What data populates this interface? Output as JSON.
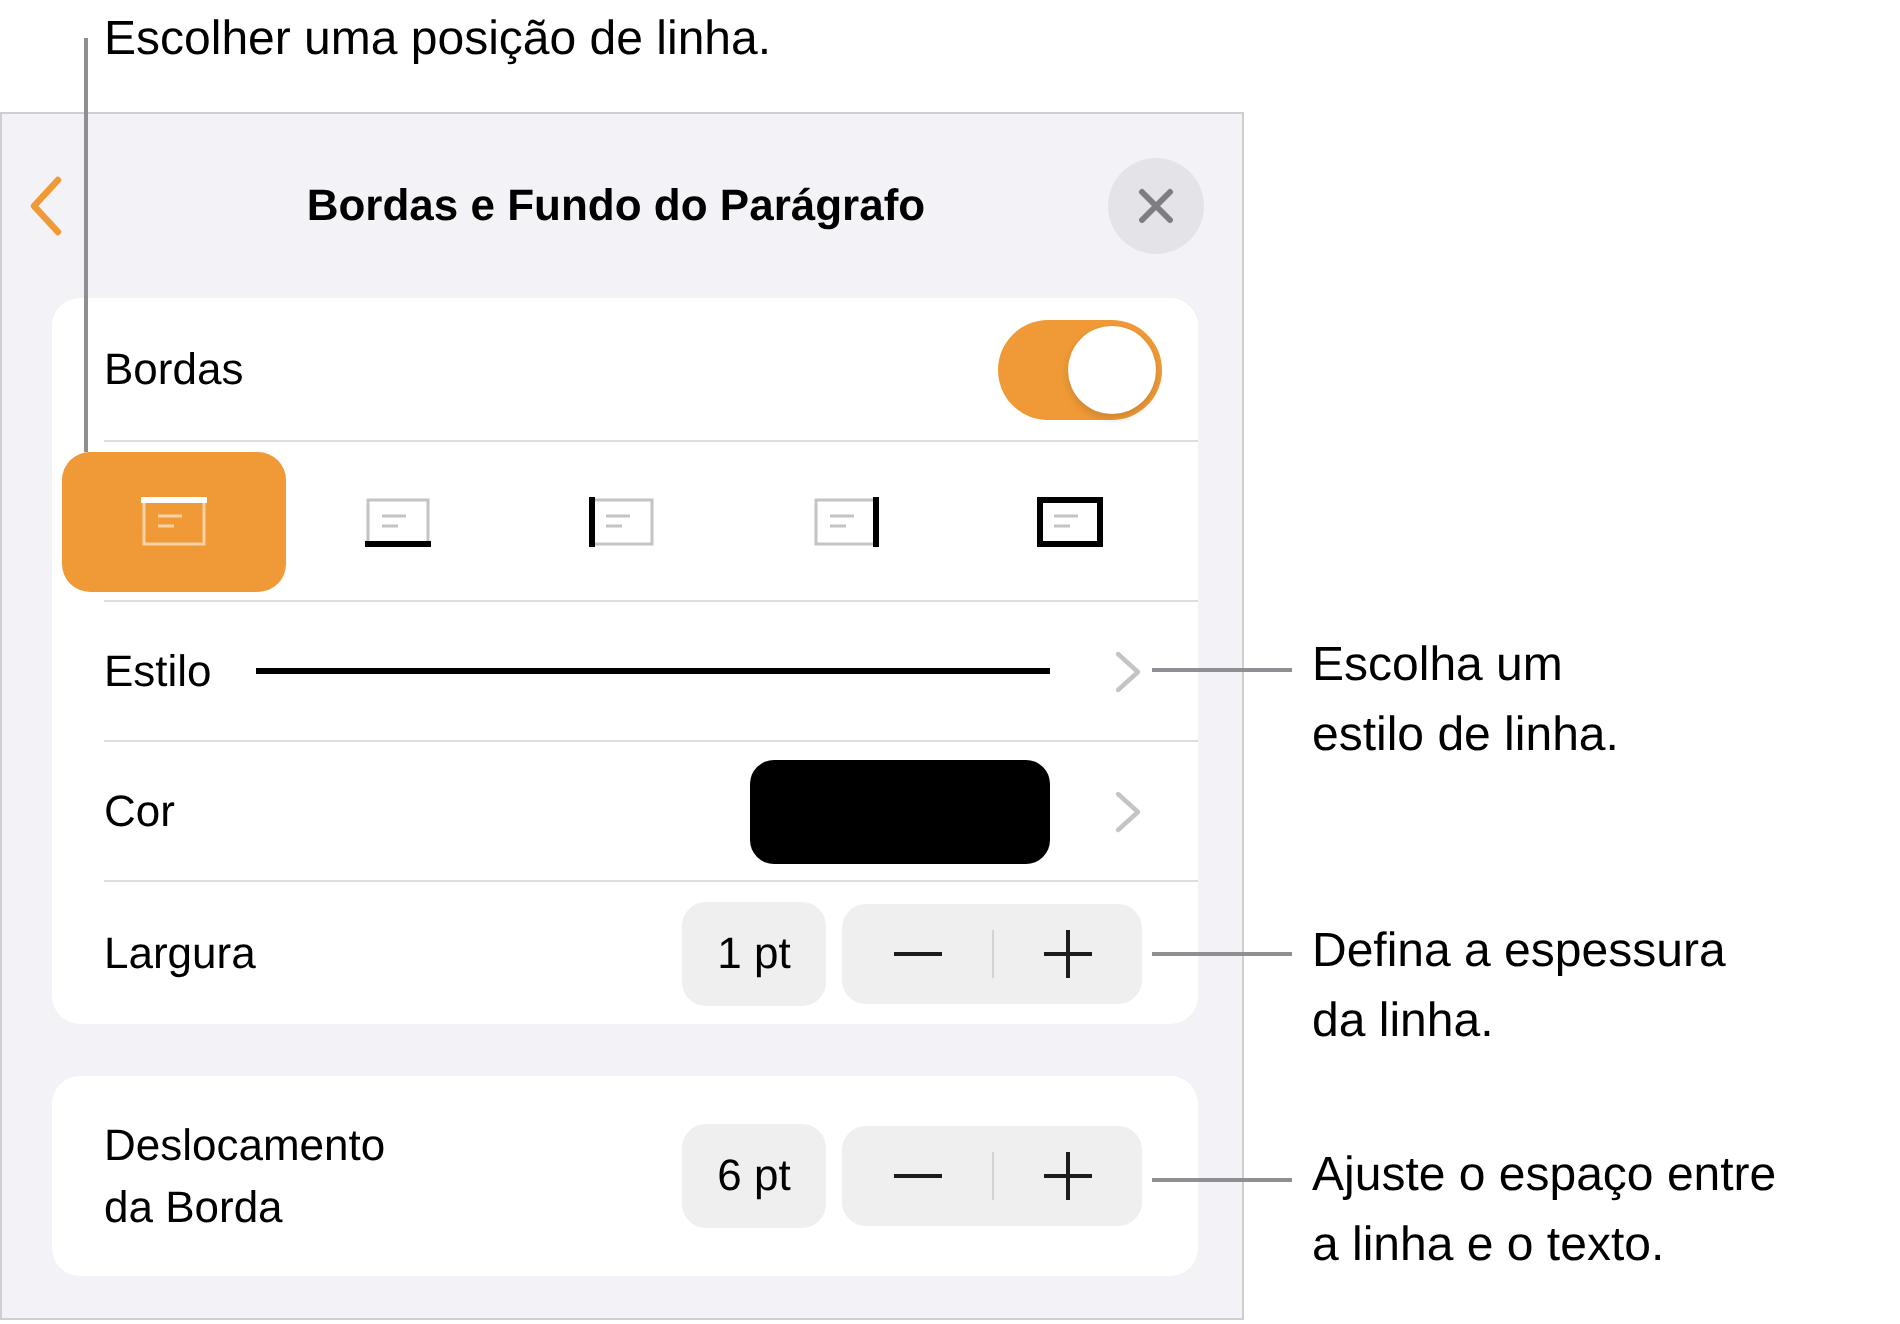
{
  "callouts": [
    {
      "text": "Escolher uma posição de linha."
    },
    {
      "text": "Escolha um\nestilo de linha."
    },
    {
      "text": "Defina a espessura\nda linha."
    },
    {
      "text": "Ajuste o espaço entre\na linha e o texto."
    }
  ],
  "panel": {
    "title": "Bordas e Fundo do Parágrafo"
  },
  "borders": {
    "label": "Bordas",
    "on": true
  },
  "positions": [
    {
      "kind": "top",
      "selected": true
    },
    {
      "kind": "bottom",
      "selected": false
    },
    {
      "kind": "left",
      "selected": false
    },
    {
      "kind": "right",
      "selected": false
    },
    {
      "kind": "all",
      "selected": false
    }
  ],
  "style": {
    "label": "Estilo"
  },
  "color": {
    "label": "Cor",
    "color": "#000000"
  },
  "width": {
    "label": "Largura",
    "value": "1 pt"
  },
  "offset": {
    "label": "Deslocamento\nda Borda",
    "value": "6 pt"
  }
}
